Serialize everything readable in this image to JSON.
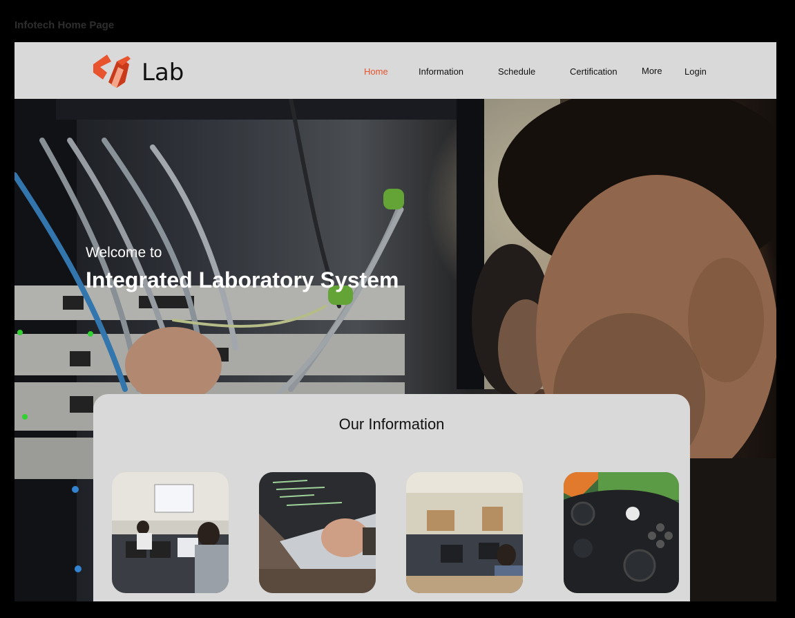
{
  "canvas": {
    "label": "Infotech Home Page"
  },
  "brand": {
    "logo_text": "Lab",
    "accent": "#e8542d"
  },
  "nav": {
    "items": [
      {
        "label": "Home",
        "active": true
      },
      {
        "label": "Information"
      },
      {
        "label": "Schedule"
      },
      {
        "label": "Certification"
      },
      {
        "label": "More"
      },
      {
        "label": "Login"
      }
    ]
  },
  "hero": {
    "welcome": "Welcome to",
    "title": "Integrated Laboratory System"
  },
  "info": {
    "title": "Our Information",
    "cards": [
      {
        "image": "computer-lab-photo"
      },
      {
        "image": "laptop-typing-photo"
      },
      {
        "image": "classroom-lab-photo"
      },
      {
        "image": "game-controller-photo"
      }
    ]
  }
}
